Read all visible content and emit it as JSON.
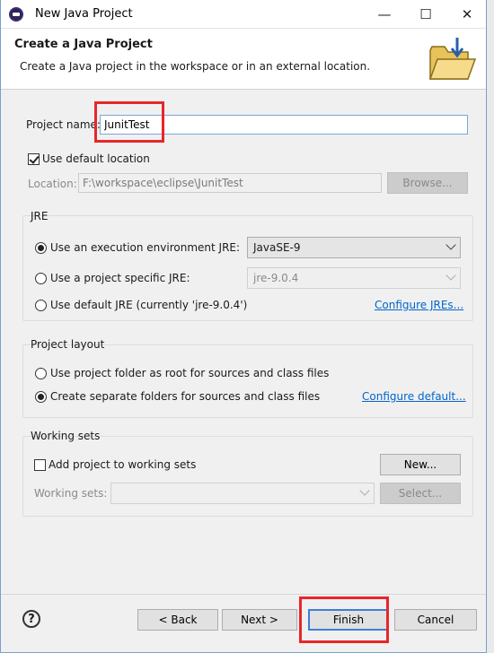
{
  "window": {
    "title": "New Java Project",
    "minimize_glyph": "—",
    "maximize_glyph": "☐",
    "close_glyph": "✕"
  },
  "header": {
    "title": "Create a Java Project",
    "description": "Create a Java project in the workspace or in an external location."
  },
  "project_name": {
    "label": "Project name:",
    "value": "JunitTest"
  },
  "location": {
    "use_default_label": "Use default location",
    "use_default_checked": true,
    "label": "Location:",
    "value": "F:\\workspace\\eclipse\\JunitTest",
    "browse_label": "Browse..."
  },
  "jre": {
    "group_title": "JRE",
    "option_env_label": "Use an execution environment JRE:",
    "option_env_value": "JavaSE-9",
    "option_specific_label": "Use a project specific JRE:",
    "option_specific_value": "jre-9.0.4",
    "option_default_label": "Use default JRE (currently 'jre-9.0.4')",
    "configure_link": "Configure JREs...",
    "selected": "env"
  },
  "project_layout": {
    "group_title": "Project layout",
    "option_root_label": "Use project folder as root for sources and class files",
    "option_separate_label": "Create separate folders for sources and class files",
    "configure_link": "Configure default...",
    "selected": "separate"
  },
  "working_sets": {
    "group_title": "Working sets",
    "add_label": "Add project to working sets",
    "new_button": "New...",
    "sets_label": "Working sets:",
    "select_button": "Select..."
  },
  "footer": {
    "help_glyph": "?",
    "back_label": "< Back",
    "next_label": "Next >",
    "finish_label": "Finish",
    "cancel_label": "Cancel"
  },
  "colors": {
    "highlight_box": "#e8262a",
    "link": "#0066cc",
    "focus_border": "#3c7fd6"
  },
  "icons": {
    "app": "eclipse-icon",
    "banner": "java-project-folder-icon",
    "help": "help-icon"
  }
}
